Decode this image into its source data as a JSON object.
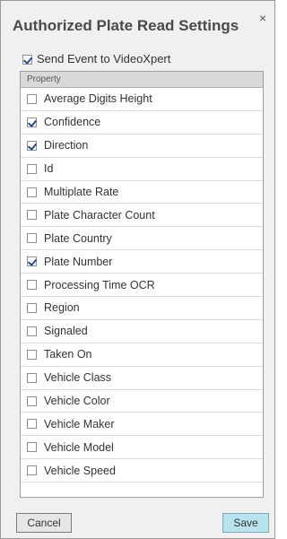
{
  "dialog": {
    "title": "Authorized Plate Read Settings",
    "close_label": "×"
  },
  "send_event": {
    "label": "Send Event to VideoXpert",
    "checked": true
  },
  "table": {
    "header": "Property",
    "rows": [
      {
        "label": "Average Digits Height",
        "checked": false
      },
      {
        "label": "Confidence",
        "checked": true
      },
      {
        "label": "Direction",
        "checked": true
      },
      {
        "label": "Id",
        "checked": false
      },
      {
        "label": "Multiplate Rate",
        "checked": false
      },
      {
        "label": "Plate Character Count",
        "checked": false
      },
      {
        "label": "Plate Country",
        "checked": false
      },
      {
        "label": "Plate Number",
        "checked": true
      },
      {
        "label": "Processing Time OCR",
        "checked": false
      },
      {
        "label": "Region",
        "checked": false
      },
      {
        "label": "Signaled",
        "checked": false
      },
      {
        "label": "Taken On",
        "checked": false
      },
      {
        "label": "Vehicle Class",
        "checked": false
      },
      {
        "label": "Vehicle Color",
        "checked": false
      },
      {
        "label": "Vehicle Maker",
        "checked": false
      },
      {
        "label": "Vehicle Model",
        "checked": false
      },
      {
        "label": "Vehicle Speed",
        "checked": false
      }
    ]
  },
  "buttons": {
    "cancel": "Cancel",
    "save": "Save"
  },
  "colors": {
    "save_button_bg": "#b8e4ef",
    "checkmark": "#1f4f8f"
  }
}
